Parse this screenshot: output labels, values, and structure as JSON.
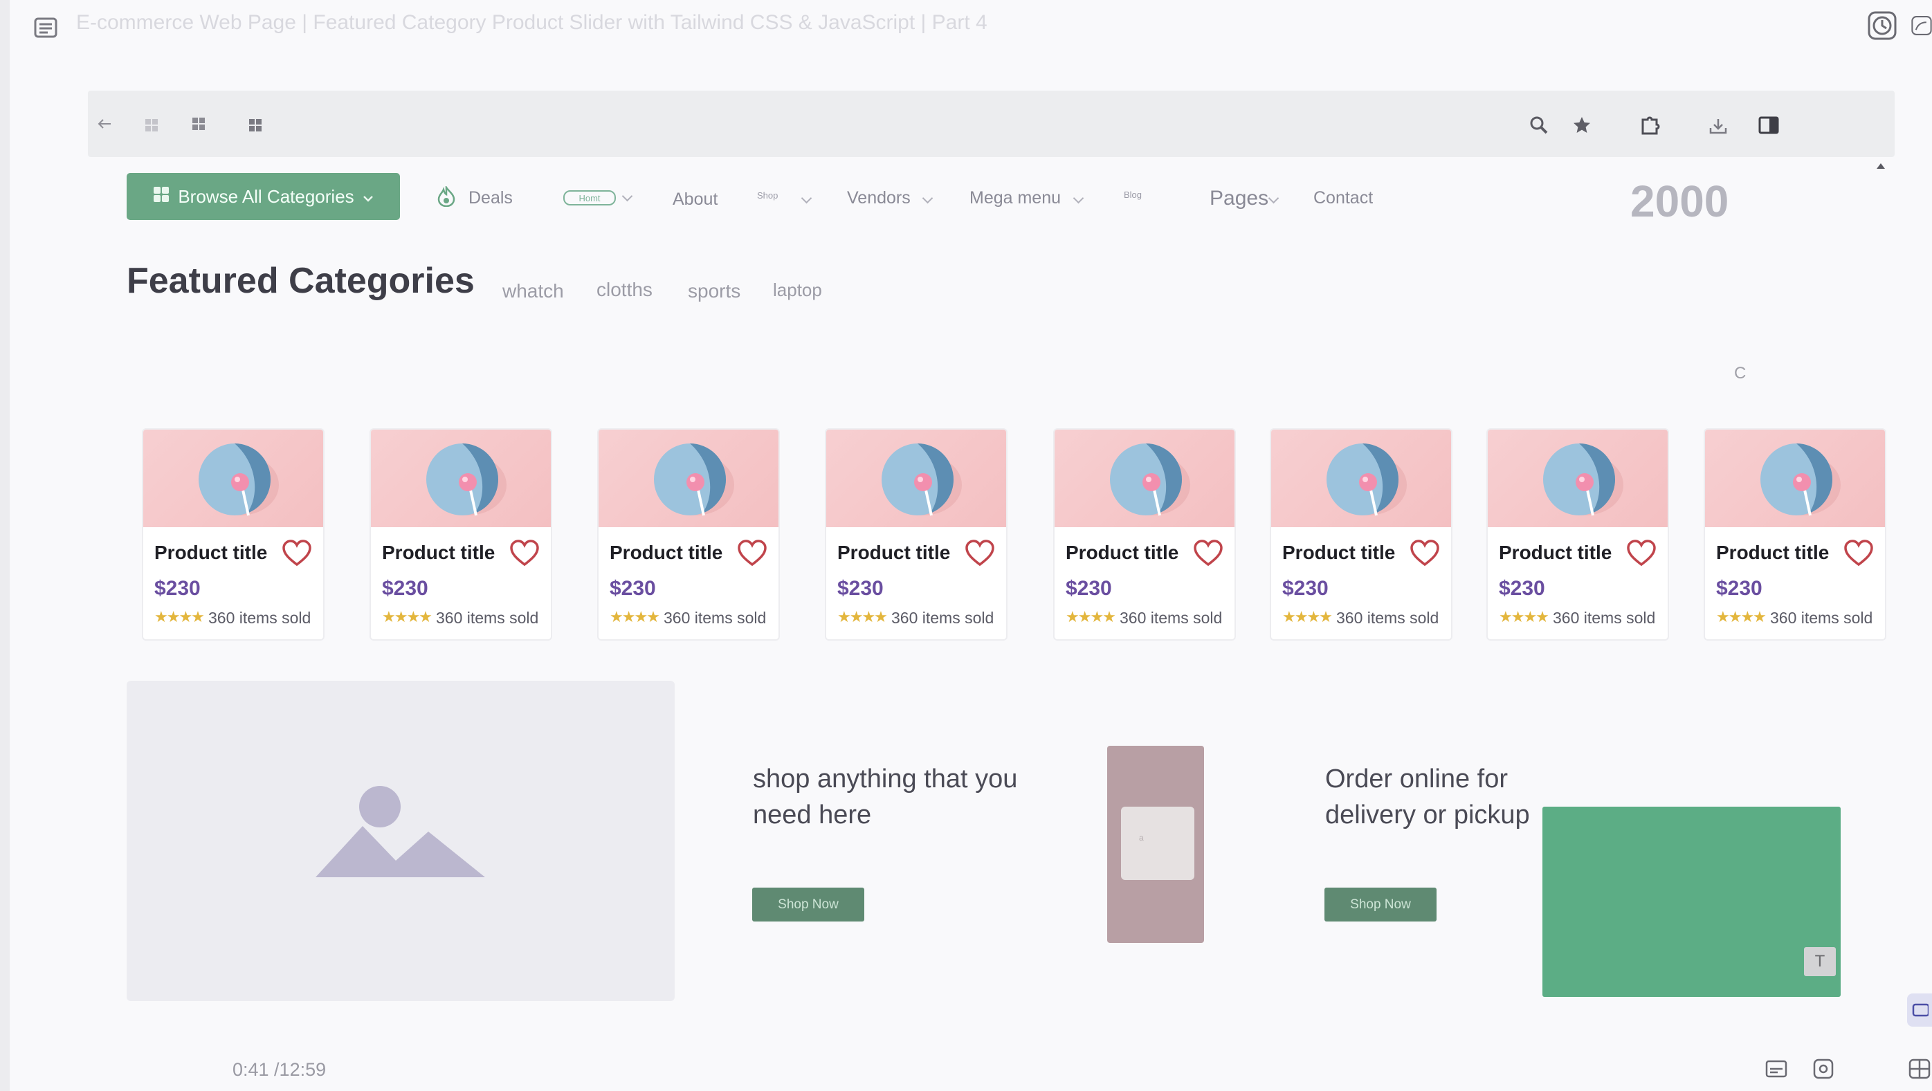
{
  "video": {
    "title": "E-commerce Web Page | Featured Category Product Slider with Tailwind CSS & JavaScript | Part 4",
    "time": "0:41 /12:59"
  },
  "browser_toolbar": {
    "icons": [
      "back-arrow-icon",
      "grid-icon",
      "grid-icon",
      "grid-icon",
      "zoom-icon",
      "star-icon",
      "extensions-icon",
      "download-icon",
      "sidebar-icon"
    ]
  },
  "nav": {
    "browse_label": "Browse All Categories",
    "deals": "Deals",
    "homt": "Homt",
    "about": "About",
    "shop": "Shop",
    "vendors": "Vendors",
    "mega_menu": "Mega menu",
    "blog": "Blog",
    "pages": "Pages",
    "contact": "Contact",
    "big_number": "2000"
  },
  "featured": {
    "title": "Featured Categories",
    "tabs": [
      "whatch",
      "clotths",
      "sports",
      "laptop"
    ],
    "stray": "C"
  },
  "products": [
    {
      "title": "Product title",
      "price": "$230",
      "stars": "★★★★",
      "sold": "360 items sold"
    },
    {
      "title": "Product title",
      "price": "$230",
      "stars": "★★★★",
      "sold": "360 items sold"
    },
    {
      "title": "Product title",
      "price": "$230",
      "stars": "★★★★",
      "sold": "360 items sold"
    },
    {
      "title": "Product title",
      "price": "$230",
      "stars": "★★★★",
      "sold": "360 items sold"
    },
    {
      "title": "Product title",
      "price": "$230",
      "stars": "★★★★",
      "sold": "360 items sold"
    },
    {
      "title": "Product title",
      "price": "$230",
      "stars": "★★★★",
      "sold": "360 items sold"
    },
    {
      "title": "Product title",
      "price": "$230",
      "stars": "★★★★",
      "sold": "360 items sold"
    },
    {
      "title": "Product title",
      "price": "$230",
      "stars": "★★★★",
      "sold": "360 items sold"
    }
  ],
  "banners": {
    "first_text": "shop anything that you need here",
    "second_text": "Order online for delivery or pickup",
    "button": "Shop Now",
    "pink_inner": "a",
    "badge": "T"
  },
  "colors": {
    "accent_green": "#6aa785",
    "price_purple": "#6a4ea0",
    "heart_red": "#c0444b",
    "star_gold": "#e3b63d"
  }
}
